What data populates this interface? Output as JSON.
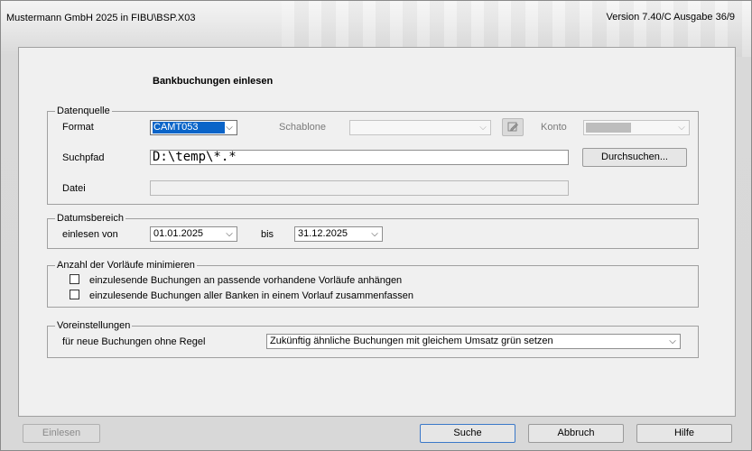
{
  "app": {
    "title": "Mustermann GmbH 2025 in FIBU\\BSP.X03",
    "version": "Version 7.40/C Ausgabe 36/9"
  },
  "dialog": {
    "heading": "Bankbuchungen einlesen"
  },
  "datenquelle": {
    "legend": "Datenquelle",
    "format_label": "Format",
    "format_value": "CAMT053",
    "schablone_label": "Schablone",
    "schablone_value": "",
    "konto_label": "Konto",
    "suchpfad_label": "Suchpfad",
    "suchpfad_value": "D:\\temp\\*.*",
    "browse_button": "Durchsuchen...",
    "datei_label": "Datei",
    "datei_value": ""
  },
  "datumsbereich": {
    "legend": "Datumsbereich",
    "from_label": "einlesen von",
    "from_value": "01.01.2025",
    "to_label": "bis",
    "to_value": "31.12.2025"
  },
  "vorlaeufe": {
    "legend": "Anzahl der Vorläufe minimieren",
    "option1": "einzulesende Buchungen an passende vorhandene Vorläufe anhängen",
    "option1_checked": false,
    "option2": "einzulesende Buchungen aller Banken in einem Vorlauf zusammenfassen",
    "option2_checked": false
  },
  "voreinstellungen": {
    "legend": "Voreinstellungen",
    "rule_label": "für neue Buchungen ohne Regel",
    "rule_value": "Zukünftig ähnliche Buchungen mit gleichem Umsatz grün setzen"
  },
  "footer": {
    "einlesen": "Einlesen",
    "suche": "Suche",
    "abbruch": "Abbruch",
    "hilfe": "Hilfe"
  },
  "icons": {
    "dropdown": "chevron-down-icon",
    "edit": "edit-template-icon"
  }
}
